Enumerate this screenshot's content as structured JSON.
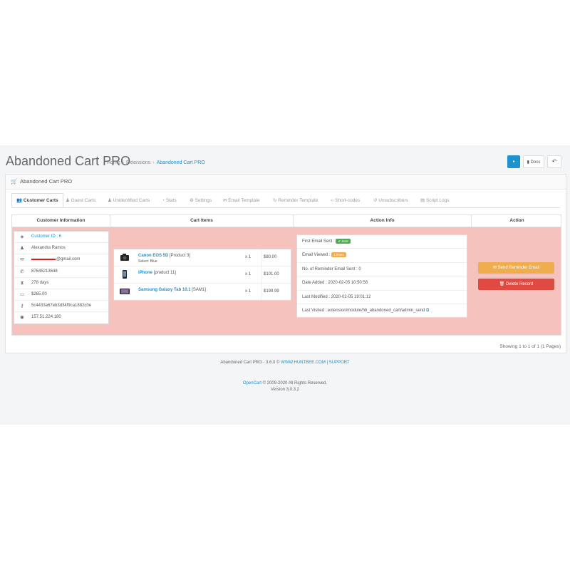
{
  "header": {
    "title": "Abandoned Cart PRO",
    "breadcrumb": [
      "Home",
      "Extensions",
      "Abandoned Cart PRO"
    ],
    "docs_label": "Docs"
  },
  "panel": {
    "heading": "Abandoned Cart PRO"
  },
  "tabs": [
    {
      "label": "Customer Carts",
      "active": true
    },
    {
      "label": "Guest Carts"
    },
    {
      "label": "Unidentified Carts"
    },
    {
      "label": "Stats"
    },
    {
      "label": "Settings"
    },
    {
      "label": "Email Template"
    },
    {
      "label": "Reminder Template"
    },
    {
      "label": "Short-codes"
    },
    {
      "label": "Unsubscribers"
    },
    {
      "label": "Script Logs"
    }
  ],
  "table": {
    "headers": [
      "Customer Information",
      "Cart Items",
      "Action Info",
      "Action"
    ]
  },
  "customer": {
    "id": "Customer ID : 6",
    "name": "Alexandra Ramos",
    "email_visible": "@gmail.com",
    "phone": "87645213648",
    "days": "278 days",
    "total": "$265.00",
    "session": "5c4433a67eb3d34f9ca1882c0e",
    "ip": "157.51.224.180"
  },
  "cart_items": [
    {
      "name": "Canon EOS 5D",
      "model": "[Product 3]",
      "option": "Select: Blue",
      "qty": "x 1",
      "price": "$80.00"
    },
    {
      "name": "iPhone",
      "model": "[product 11]",
      "option": "",
      "qty": "x 1",
      "price": "$101.00"
    },
    {
      "name": "Samsung Galaxy Tab 10.1",
      "model": "[SAM1]",
      "option": "",
      "qty": "x 1",
      "price": "$199.99"
    }
  ],
  "action_info": {
    "first_email_label": "First Email Sent :",
    "first_email_badge": "✔ Sent",
    "email_viewed_label": "Email Viewed :",
    "email_viewed_badge": "1 times",
    "reminder_count": "No. of Reminder Email Sent : 0",
    "date_added": "Date Added : 2020-02-05 10:50:58",
    "last_modified": "Last Modified : 2020-02-05 19:01:12",
    "last_visited": "Last Visited : extension/module/hb_abandoned_cart/admin_send"
  },
  "actions": {
    "send_label": "Send Reminder Email",
    "delete_label": "Delete Record"
  },
  "pagination": {
    "showing": "Showing 1 to 1 of 1 (1 Pages)"
  },
  "footer": {
    "module_text": "Abandoned Cart PRO - 3.6.0 ©",
    "module_link": "WWW.HUNTBEE.COM",
    "support_link": "SUPPORT",
    "opencart_link": "OpenCart",
    "copyright": "© 2009-2020 All Rights Reserved.",
    "version": "Version 3.0.3.2"
  },
  "colors": {
    "accent": "#1e91cf",
    "row_highlight": "#f6c2be",
    "warning": "#f0ad4e",
    "danger": "#e14a40",
    "success": "#4cae4c"
  }
}
